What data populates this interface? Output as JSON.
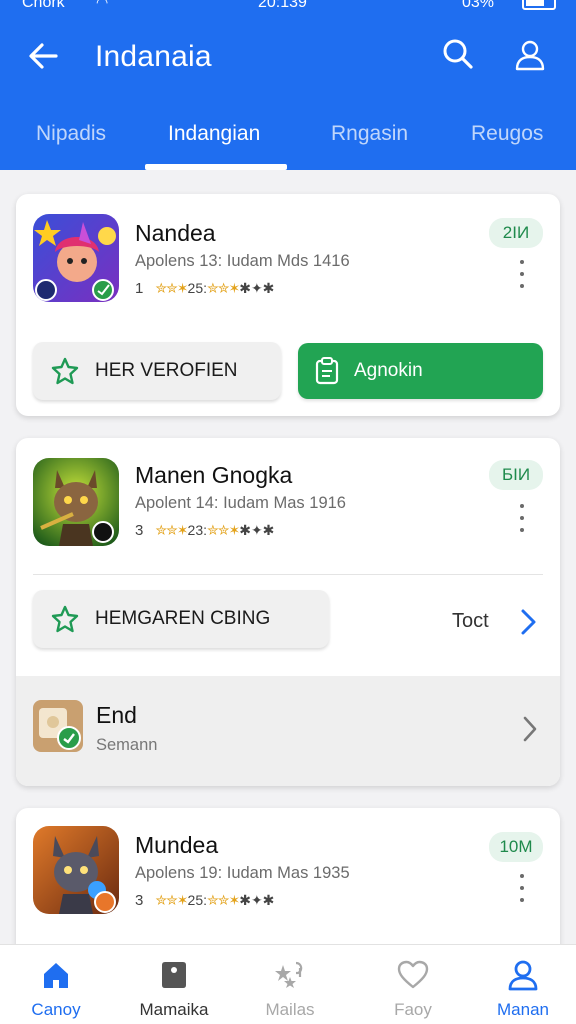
{
  "status_bar": {
    "carrier": "Chork",
    "time": "20:139",
    "battery": "03%"
  },
  "header": {
    "title": "Indanaia"
  },
  "tabs": [
    {
      "label": "Nipadis",
      "active": false
    },
    {
      "label": "Indangian",
      "active": true
    },
    {
      "label": "Rngasin",
      "active": false
    },
    {
      "label": "Reugos",
      "active": false
    }
  ],
  "apps": [
    {
      "name": "Nandea",
      "meta": "Apolens 13: Iudam Mds 1416",
      "rating_count": "1",
      "stars": "✮✮✶",
      "rating_value": "25:",
      "stars2": "✮✮✶",
      "rating_suffix": "✱✦✱",
      "size": "2IИ",
      "secondary_label": "HER VEROFIEN",
      "primary_label": "Agnokin"
    },
    {
      "name": "Manen Gnogka",
      "meta": "Apolent 14: Iudam Mas 1916",
      "rating_count": "3",
      "stars": "✮✮✶",
      "rating_value": "23:",
      "stars2": "✮✮✶",
      "rating_suffix": "✱✦✱",
      "size": "БIИ",
      "secondary_label": "HEMGAREN CBING",
      "link_label": "Toct",
      "sub_item": {
        "title": "End",
        "subtitle": "Semann"
      }
    },
    {
      "name": "Mundea",
      "meta": "Apolens 19: Iudam Mas 1935",
      "rating_count": "3",
      "stars": "✮✮✶",
      "rating_value": "25:",
      "stars2": "✮✮✶",
      "rating_suffix": "✱✦✱",
      "size": "10M"
    }
  ],
  "bottom_nav": [
    {
      "label": "Canoy",
      "icon": "home-icon",
      "color": "#1f6ef0"
    },
    {
      "label": "Mamaika",
      "icon": "tag-icon",
      "color": "#333333"
    },
    {
      "label": "Mailas",
      "icon": "stars-icon",
      "color": "#a8a8a8"
    },
    {
      "label": "Faoy",
      "icon": "heart-icon",
      "color": "#a8a8a8"
    },
    {
      "label": "Manan",
      "icon": "profile-icon",
      "color": "#1f6ef0"
    }
  ],
  "colors": {
    "brand": "#1f6ef0",
    "accent_green": "#22a453",
    "badge_green": "#1f8a4c"
  }
}
